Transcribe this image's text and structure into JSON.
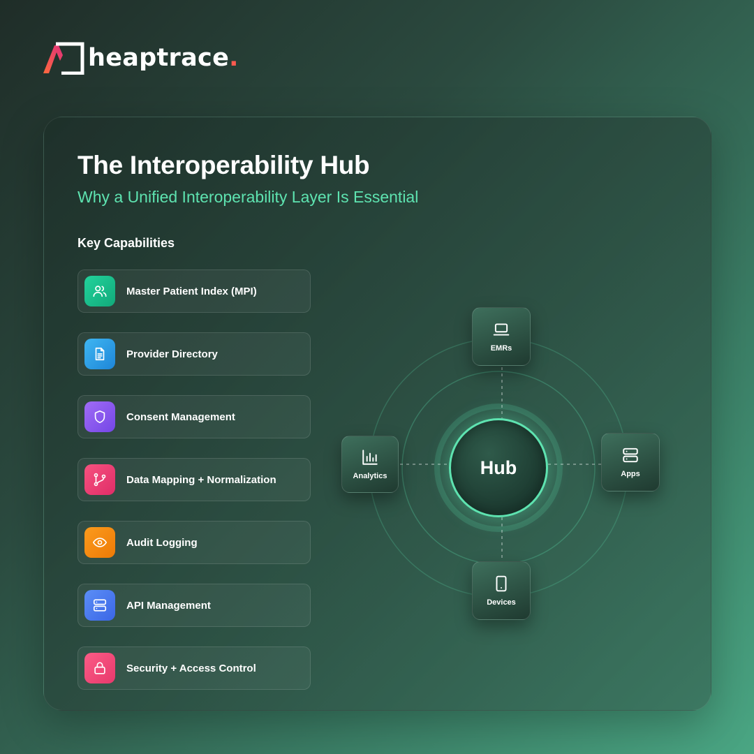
{
  "brand": {
    "name": "heaptrace",
    "dot": ".",
    "accent": "#ff5a4f"
  },
  "card": {
    "title": "The Interoperability Hub",
    "subtitle": "Why a Unified Interoperability Layer Is Essential",
    "section_label": "Key Capabilities"
  },
  "capabilities": [
    {
      "label": "Master Patient Index (MPI)",
      "icon": "users-icon",
      "color": "#18c08e"
    },
    {
      "label": "Provider Directory",
      "icon": "document-icon",
      "color": "#2b9ee8"
    },
    {
      "label": "Consent Management",
      "icon": "shield-icon",
      "color": "#8b5cf0"
    },
    {
      "label": "Data Mapping + Normalization",
      "icon": "git-branch-icon",
      "color": "#ee3f77"
    },
    {
      "label": "Audit Logging",
      "icon": "eye-icon",
      "color": "#f58a0b"
    },
    {
      "label": "API Management",
      "icon": "server-icon",
      "color": "#4b7bf0"
    },
    {
      "label": "Security + Access Control",
      "icon": "lock-icon",
      "color": "#f2457a"
    }
  ],
  "hub": {
    "center": "Hub",
    "nodes": [
      {
        "label": "EMRs",
        "icon": "laptop-icon"
      },
      {
        "label": "Apps",
        "icon": "server-icon"
      },
      {
        "label": "Devices",
        "icon": "tablet-icon"
      },
      {
        "label": "Analytics",
        "icon": "bar-chart-icon"
      }
    ],
    "accent": "#5ee3b0"
  }
}
